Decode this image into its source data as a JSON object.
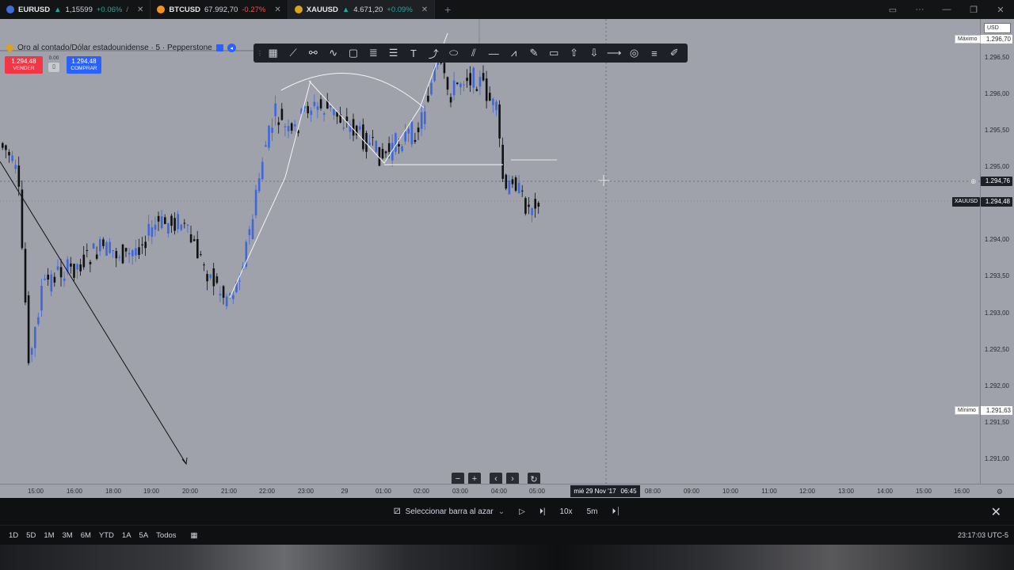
{
  "tabs": [
    {
      "symbol": "EURUSD",
      "arrow": "▲",
      "price": "1,15599",
      "change": "+0.06%",
      "dir": "up",
      "coin": "#3d6fd6",
      "more": "/"
    },
    {
      "symbol": "BTCUSD",
      "arrow": "",
      "price": "67.992,70",
      "change": "-0.27%",
      "dir": "down",
      "coin": "#f7931a",
      "more": ""
    },
    {
      "symbol": "XAUUSD",
      "arrow": "▲",
      "price": "4.671,20",
      "change": "+0.09%",
      "dir": "up",
      "coin": "#d9a31a",
      "more": ""
    }
  ],
  "chart": {
    "title": "Oro al contado/Dólar estadounidense · 5 · Pepperstone",
    "sell_price": "1.294,48",
    "sell_label": "VENDER",
    "buy_price": "1.294,48",
    "buy_label": "COMPRAR",
    "spread": "0.00",
    "currency": "USD",
    "symbol_tag": "XAUUSD",
    "last_price": "1.294,48",
    "crosshair_price": "1.294,76",
    "max_label": "Máximo",
    "max_value": "1.296,70",
    "min_label": "Mínimo",
    "min_value": "1.291,63",
    "crosshair_date": "mié 29 Nov '17",
    "crosshair_time": "06:45",
    "background": "#9fa2ab",
    "up_color": "#3f67d8",
    "down_color": "#111111"
  },
  "price_axis": [
    "1.296,50",
    "1.296,00",
    "1.295,50",
    "1.295,00",
    "1.294,00",
    "1.293,50",
    "1.293,00",
    "1.292,50",
    "1.292,00",
    "1.291,50",
    "1.291,00"
  ],
  "time_axis": [
    "15:00",
    "16:00",
    "18:00",
    "19:00",
    "20:00",
    "21:00",
    "22:00",
    "23:00",
    "29",
    "01:00",
    "02:00",
    "03:00",
    "04:00",
    "05:00",
    "08:00",
    "09:00",
    "10:00",
    "11:00",
    "12:00",
    "13:00",
    "14:00",
    "15:00",
    "16:00"
  ],
  "drawing_tools": [
    "grid-icon",
    "trendline-icon",
    "fib-icon",
    "path-icon",
    "rectangle-icon",
    "parallel-icon",
    "channel-icon",
    "text-icon",
    "curve-icon",
    "ellipse-icon",
    "pitchfork-icon",
    "hline-icon",
    "zigzag-icon",
    "brush-icon",
    "note-icon",
    "arrow-up-icon",
    "arrow-down-icon",
    "ray-icon",
    "target-icon",
    "lines-icon",
    "pen-icon"
  ],
  "replay": {
    "select_label": "Seleccionar barra al azar",
    "speed": "10x",
    "interval": "5m"
  },
  "ranges": [
    "1D",
    "5D",
    "1M",
    "3M",
    "6M",
    "YTD",
    "1A",
    "5A",
    "Todos"
  ],
  "clock": "23:17:03 UTC-5"
}
